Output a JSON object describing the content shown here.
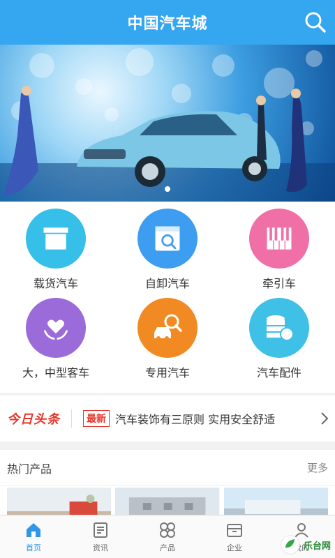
{
  "header": {
    "title": "中国汽车城",
    "search_icon": "search-icon"
  },
  "banner": {
    "slide_count": 1,
    "active_index": 0
  },
  "categories": [
    {
      "label": "载货汽车",
      "icon": "box-icon",
      "color": "#36bfe8"
    },
    {
      "label": "自卸汽车",
      "icon": "box-search-icon",
      "color": "#3d9df0"
    },
    {
      "label": "牵引车",
      "icon": "piano-keys-icon",
      "color": "#f06fa6"
    },
    {
      "label": "大，中型客车",
      "icon": "heart-hands-icon",
      "color": "#9b6bd9"
    },
    {
      "label": "专用汽车",
      "icon": "car-search-icon",
      "color": "#f28a24"
    },
    {
      "label": "汽车配件",
      "icon": "coins-stack-icon",
      "color": "#3fc0e6"
    }
  ],
  "headline": {
    "brand": "今日头条",
    "tag": "最新",
    "text": "汽车装饰有三原则 实用安全舒适"
  },
  "hot": {
    "title": "热门产品",
    "more": "更多"
  },
  "nav": {
    "items": [
      {
        "label": "首页",
        "icon": "home-icon",
        "active": true
      },
      {
        "label": "资讯",
        "icon": "news-icon",
        "active": false
      },
      {
        "label": "产品",
        "icon": "grid-icon",
        "active": false
      },
      {
        "label": "企业",
        "icon": "building-icon",
        "active": false
      },
      {
        "label": "我的",
        "icon": "user-icon",
        "active": false
      }
    ]
  },
  "watermark": {
    "text": "乐台网"
  }
}
